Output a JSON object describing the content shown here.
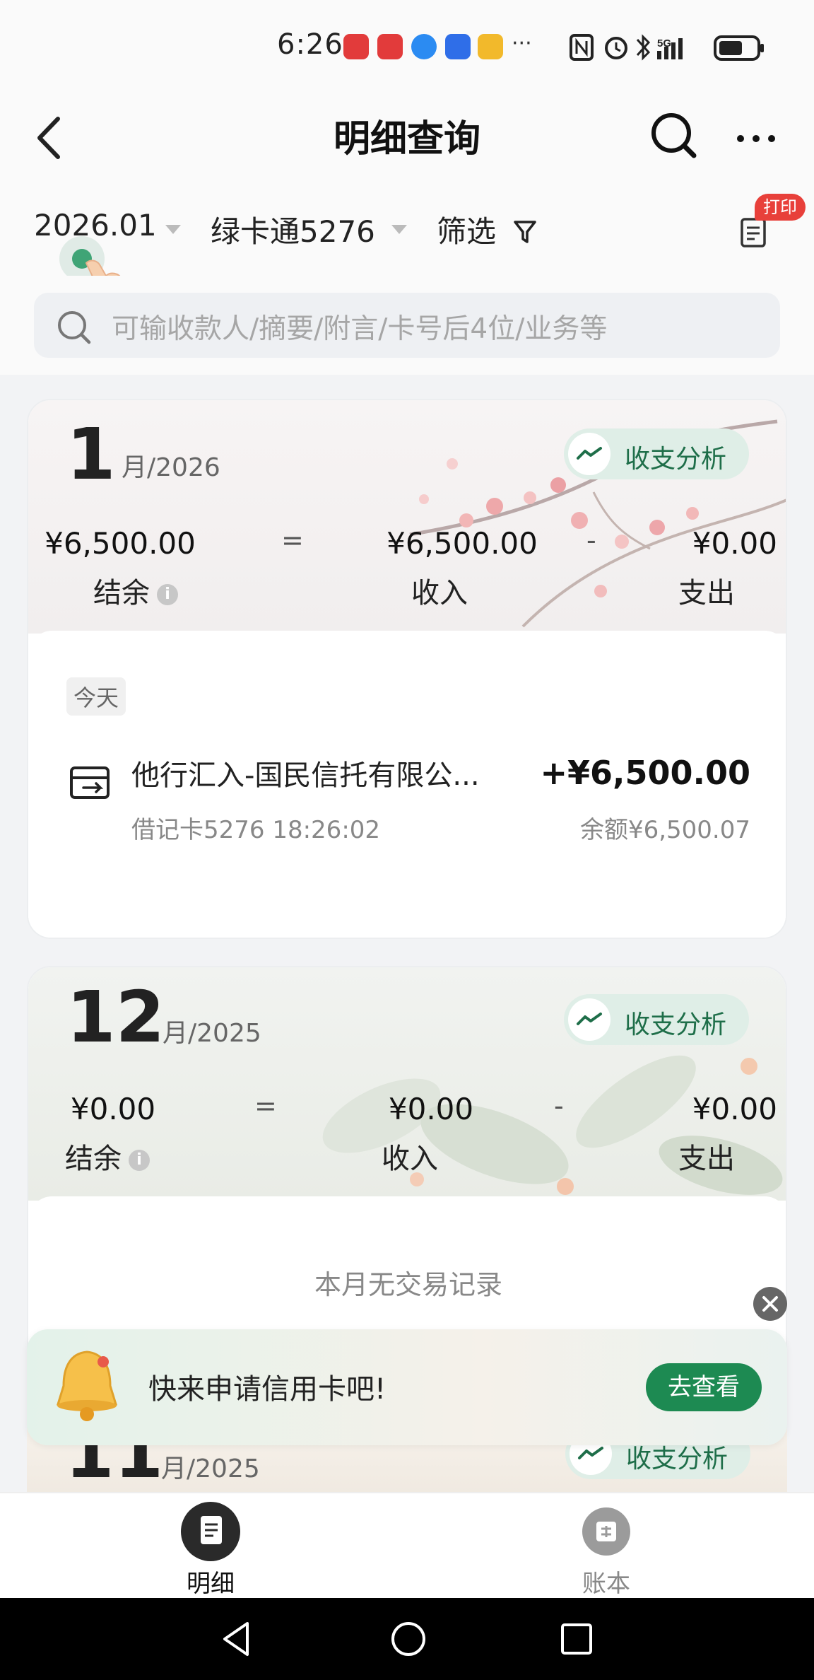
{
  "status_bar": {
    "time": "6:26",
    "ellipsis": "···"
  },
  "header": {
    "title": "明细查询"
  },
  "filters": {
    "month": "2026.01",
    "card": "绿卡通5276",
    "filter": "筛选",
    "print_badge": "打印"
  },
  "search": {
    "placeholder": "可输收款人/摘要/附言/卡号后4位/业务等"
  },
  "months": [
    {
      "month": "1",
      "year_label": "月/2026",
      "analysis_label": "收支分析",
      "balance": "¥6,500.00",
      "income": "¥6,500.00",
      "expense": "¥0.00",
      "balance_label": "结余",
      "income_label": "收入",
      "expense_label": "支出",
      "eq": "=",
      "minus": "-",
      "day_tag": "今天",
      "transaction": {
        "title": "他行汇入-国民信托有限公...",
        "subtitle": "借记卡5276 18:26:02",
        "amount": "+¥6,500.00",
        "balance_after": "余额¥6,500.07"
      }
    },
    {
      "month": "12",
      "year_label": "月/2025",
      "analysis_label": "收支分析",
      "balance": "¥0.00",
      "income": "¥0.00",
      "expense": "¥0.00",
      "balance_label": "结余",
      "income_label": "收入",
      "expense_label": "支出",
      "eq": "=",
      "minus": "-",
      "empty_text": "本月无交易记录"
    },
    {
      "month": "11",
      "year_label": "月/2025",
      "analysis_label": "收支分析"
    }
  ],
  "promo": {
    "text": "快来申请信用卡吧!",
    "button": "去查看"
  },
  "bottom_nav": {
    "items": [
      {
        "label": "明细"
      },
      {
        "label": "账本"
      }
    ]
  },
  "colors": {
    "accent_green": "#1d8a52",
    "pill_bg": "#dfeee7",
    "badge_red": "#e8403a"
  }
}
